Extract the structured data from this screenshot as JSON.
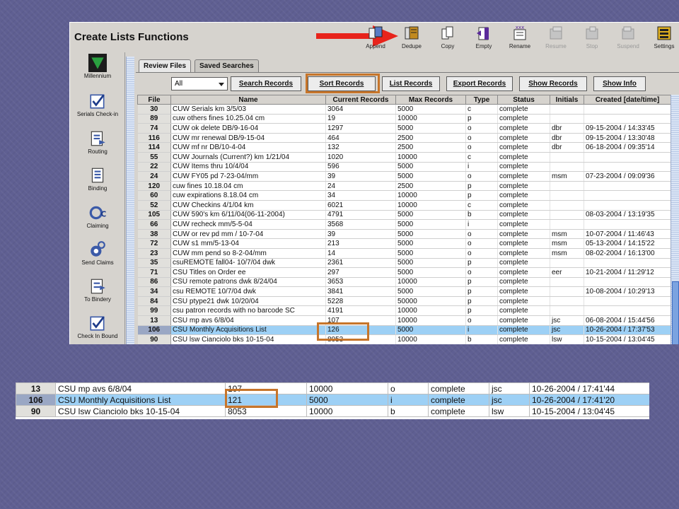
{
  "app": {
    "title": "Create Lists Functions"
  },
  "toolbar": [
    {
      "label": "Append",
      "icon": "append-icon",
      "enabled": true
    },
    {
      "label": "Dedupe",
      "icon": "dedupe-icon",
      "enabled": true
    },
    {
      "label": "Copy",
      "icon": "copy-icon",
      "enabled": true
    },
    {
      "label": "Empty",
      "icon": "empty-icon",
      "enabled": true
    },
    {
      "label": "Rename",
      "icon": "rename-icon",
      "enabled": true
    },
    {
      "label": "Resume",
      "icon": "resume-icon",
      "enabled": false
    },
    {
      "label": "Stop",
      "icon": "stop-icon",
      "enabled": false
    },
    {
      "label": "Suspend",
      "icon": "suspend-icon",
      "enabled": false
    },
    {
      "label": "Settings",
      "icon": "settings-icon",
      "enabled": true
    }
  ],
  "sidebar": [
    {
      "label": "Millennium",
      "icon": "millennium-icon"
    },
    {
      "label": "Serials Check-in",
      "icon": "serials-checkin-icon"
    },
    {
      "label": "Routing",
      "icon": "routing-icon"
    },
    {
      "label": "Binding",
      "icon": "binding-icon"
    },
    {
      "label": "Claiming",
      "icon": "claiming-icon"
    },
    {
      "label": "Send Claims",
      "icon": "send-claims-icon"
    },
    {
      "label": "To Bindery",
      "icon": "to-bindery-icon"
    },
    {
      "label": "Check In Bound",
      "icon": "check-in-bound-icon"
    }
  ],
  "tabs": {
    "review": "Review Files",
    "saved": "Saved Searches"
  },
  "filter": {
    "selected": "All"
  },
  "actions": {
    "search": "Search Records",
    "sort": "Sort Records",
    "list": "List Records",
    "export": "Export Records",
    "show": "Show Records",
    "info": "Show Info"
  },
  "table": {
    "headers": [
      "File",
      "Name",
      "Current Records",
      "Max Records",
      "Type",
      "Status",
      "Initials",
      "Created [date/time]"
    ],
    "rows": [
      [
        "30",
        "CUW Serials km 3/5/03",
        "3064",
        "5000",
        "c",
        "complete",
        "",
        ""
      ],
      [
        "89",
        "cuw others fines 10.25.04 cm",
        "19",
        "10000",
        "p",
        "complete",
        "",
        ""
      ],
      [
        "74",
        "CUW ok delete                    DB/9-16-04",
        "1297",
        "5000",
        "o",
        "complete",
        "dbr",
        "09-15-2004 / 14:33'45"
      ],
      [
        "116",
        "CUW mr renewal                    DB/9-15-04",
        "464",
        "2500",
        "o",
        "complete",
        "dbr",
        "09-15-2004 / 13:30'48"
      ],
      [
        "114",
        "CUW mf nr                    DB/10-4-04",
        "132",
        "2500",
        "o",
        "complete",
        "dbr",
        "06-18-2004 / 09:35'14"
      ],
      [
        "55",
        "CUW Journals (Current?) km 1/21/04",
        "1020",
        "10000",
        "c",
        "complete",
        "",
        ""
      ],
      [
        "22",
        "CUW Items thru 10/4/04",
        "596",
        "5000",
        "i",
        "complete",
        "",
        ""
      ],
      [
        "24",
        "CUW FY05 pd  7-23-04/mm",
        "39",
        "5000",
        "o",
        "complete",
        "msm",
        "07-23-2004 / 09:09'36"
      ],
      [
        "120",
        "cuw fines 10.18.04 cm",
        "24",
        "2500",
        "p",
        "complete",
        "",
        ""
      ],
      [
        "60",
        "cuw expirations 8.18.04 cm",
        "34",
        "10000",
        "p",
        "complete",
        "",
        ""
      ],
      [
        "52",
        "CUW Checkins 4/1/04 km",
        "6021",
        "10000",
        "c",
        "complete",
        "",
        ""
      ],
      [
        "105",
        "CUW 590's km 6/11/04(06-11-2004)",
        "4791",
        "5000",
        "b",
        "complete",
        "",
        "08-03-2004 / 13:19'35"
      ],
      [
        "66",
        "CUW  recheck  mm/5-5-04",
        "3568",
        "5000",
        "i",
        "complete",
        "",
        ""
      ],
      [
        "38",
        "CUW  or rev pd  mm / 10-7-04",
        "39",
        "5000",
        "o",
        "complete",
        "msm",
        "10-07-2004 / 11:46'43"
      ],
      [
        "72",
        "CUW   s1   mm/5-13-04",
        "213",
        "5000",
        "o",
        "complete",
        "msm",
        "05-13-2004 / 14:15'22"
      ],
      [
        "23",
        "CUW   mm  pend so  8-2-04/mm",
        "14",
        "5000",
        "o",
        "complete",
        "msm",
        "08-02-2004 / 16:13'00"
      ],
      [
        "35",
        "csuREMOTE fall04- 10/7/04 dwk",
        "2361",
        "5000",
        "p",
        "complete",
        "",
        ""
      ],
      [
        "71",
        "CSU Titles on Order ee",
        "297",
        "5000",
        "o",
        "complete",
        "eer",
        "10-21-2004 / 11:29'12"
      ],
      [
        "86",
        "CSU remote patrons dwk 8/24/04",
        "3653",
        "10000",
        "p",
        "complete",
        "",
        ""
      ],
      [
        "34",
        "csu REMOTE 10/7/04 dwk",
        "3841",
        "5000",
        "p",
        "complete",
        "",
        "10-08-2004 / 10:29'13"
      ],
      [
        "84",
        "CSU ptype21 dwk 10/20/04",
        "5228",
        "50000",
        "p",
        "complete",
        "",
        ""
      ],
      [
        "99",
        "csu patron records with no barcode SC",
        "4191",
        "10000",
        "p",
        "complete",
        "",
        ""
      ],
      [
        "13",
        "CSU mp avs 6/8/04",
        "107",
        "10000",
        "o",
        "complete",
        "jsc",
        "06-08-2004 / 15:44'56"
      ],
      [
        "106",
        "CSU Monthly Acquisitions List",
        "126",
        "5000",
        "i",
        "complete",
        "jsc",
        "10-26-2004 / 17:37'53"
      ],
      [
        "90",
        "CSU lsw Cianciolo bks 10-15-04",
        "8053",
        "10000",
        "b",
        "complete",
        "lsw",
        "10-15-2004 / 13:04'45"
      ]
    ],
    "selected_file": "106"
  },
  "zoom_table": {
    "rows": [
      [
        "13",
        "CSU mp avs 6/8/04",
        "107",
        "10000",
        "o",
        "complete",
        "jsc",
        "10-26-2004 / 17:41'44"
      ],
      [
        "106",
        "CSU Monthly Acquisitions List",
        "121",
        "5000",
        "i",
        "complete",
        "jsc",
        "10-26-2004 / 17:41'20"
      ],
      [
        "90",
        "CSU lsw Cianciolo bks 10-15-04",
        "8053",
        "10000",
        "b",
        "complete",
        "lsw",
        "10-15-2004 / 13:04'45"
      ]
    ],
    "selected_file": "106"
  },
  "colors": {
    "background": "#5f5f92",
    "highlight": "#c7752a",
    "selected_row": "#9dd0f5",
    "arrow": "#e8231b"
  }
}
